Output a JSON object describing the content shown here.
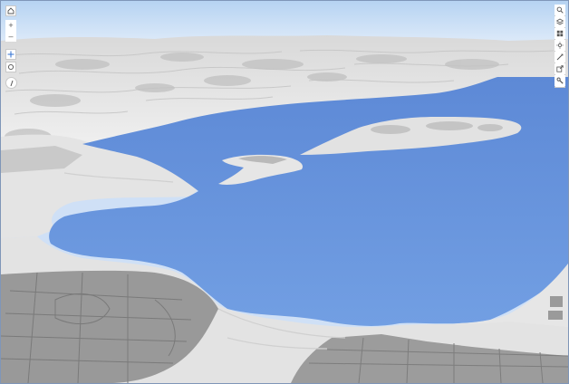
{
  "scene": {
    "sky_top": "#b9d6f3",
    "sky_bottom": "#e8f1fb",
    "water": "#6f9be0",
    "water_dark": "#5f8ad2",
    "terrain": "#e3e3e3",
    "terrain_shadow": "#bdbdbd",
    "city_blocks": "#8f8f8f"
  },
  "toolbar_left": {
    "home": {
      "icon": "home-icon"
    },
    "zoom_in": {
      "label": "+",
      "icon": "plus-icon"
    },
    "zoom_out": {
      "label": "–",
      "icon": "minus-icon"
    },
    "navigate": {
      "icon": "pan-icon",
      "active": true
    },
    "rotate": {
      "icon": "rotate-icon"
    },
    "compass": {
      "icon": "compass-icon"
    }
  },
  "toolbar_right": {
    "search": {
      "icon": "search-icon"
    },
    "layers": {
      "icon": "layers-icon"
    },
    "basemap": {
      "icon": "basemap-grid-icon"
    },
    "daylight": {
      "icon": "daylight-icon"
    },
    "measure": {
      "icon": "measure-icon"
    },
    "share": {
      "icon": "share-icon"
    },
    "settings": {
      "icon": "wrench-icon"
    }
  }
}
